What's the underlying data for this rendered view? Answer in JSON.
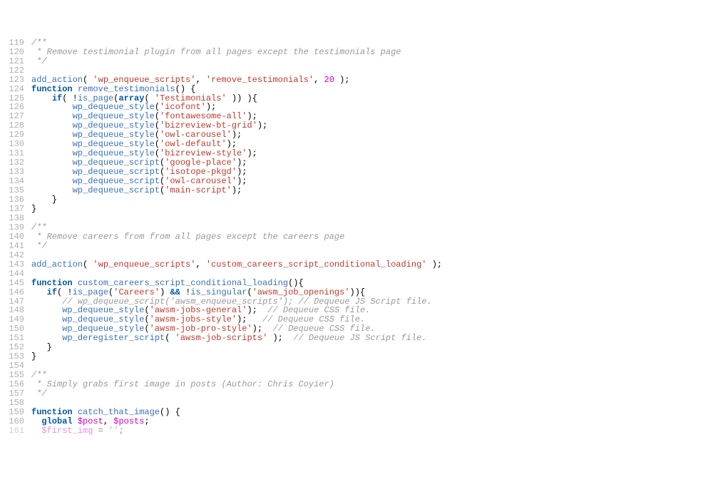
{
  "lines": [
    {
      "num": 119,
      "tokens": [
        [
          "c-comment",
          "/**"
        ]
      ]
    },
    {
      "num": 120,
      "tokens": [
        [
          "c-comment",
          " * Remove testimonial plugin from all pages except the testimonials page"
        ]
      ]
    },
    {
      "num": 121,
      "tokens": [
        [
          "c-comment",
          " */"
        ]
      ]
    },
    {
      "num": 122,
      "tokens": []
    },
    {
      "num": 123,
      "tokens": [
        [
          "c-func",
          "add_action"
        ],
        [
          "c-punct",
          "( "
        ],
        [
          "c-string",
          "'wp_enqueue_scripts'"
        ],
        [
          "c-punct",
          ", "
        ],
        [
          "c-string",
          "'remove_testimonials'"
        ],
        [
          "c-punct",
          ", "
        ],
        [
          "c-number",
          "20"
        ],
        [
          "c-punct",
          " );"
        ]
      ]
    },
    {
      "num": 124,
      "tokens": [
        [
          "c-keyword",
          "function"
        ],
        [
          "c-punct",
          " "
        ],
        [
          "c-func",
          "remove_testimonials"
        ],
        [
          "c-punct",
          "() {"
        ]
      ]
    },
    {
      "num": 125,
      "tokens": [
        [
          "c-punct",
          "    "
        ],
        [
          "c-keyword",
          "if"
        ],
        [
          "c-punct",
          "( !"
        ],
        [
          "c-func",
          "is_page"
        ],
        [
          "c-punct",
          "("
        ],
        [
          "c-keyword",
          "array"
        ],
        [
          "c-punct",
          "( "
        ],
        [
          "c-string",
          "'Testimonials'"
        ],
        [
          "c-punct",
          " )) ){"
        ]
      ]
    },
    {
      "num": 126,
      "tokens": [
        [
          "c-punct",
          "        "
        ],
        [
          "c-func",
          "wp_dequeue_style"
        ],
        [
          "c-punct",
          "("
        ],
        [
          "c-string",
          "'icofont'"
        ],
        [
          "c-punct",
          ");"
        ]
      ]
    },
    {
      "num": 127,
      "tokens": [
        [
          "c-punct",
          "        "
        ],
        [
          "c-func",
          "wp_dequeue_style"
        ],
        [
          "c-punct",
          "("
        ],
        [
          "c-string",
          "'fontawesome-all'"
        ],
        [
          "c-punct",
          ");"
        ]
      ]
    },
    {
      "num": 128,
      "tokens": [
        [
          "c-punct",
          "        "
        ],
        [
          "c-func",
          "wp_dequeue_style"
        ],
        [
          "c-punct",
          "("
        ],
        [
          "c-string",
          "'bizreview-bt-grid'"
        ],
        [
          "c-punct",
          ");"
        ]
      ]
    },
    {
      "num": 129,
      "tokens": [
        [
          "c-punct",
          "        "
        ],
        [
          "c-func",
          "wp_dequeue_style"
        ],
        [
          "c-punct",
          "("
        ],
        [
          "c-string",
          "'owl-carousel'"
        ],
        [
          "c-punct",
          ");"
        ]
      ]
    },
    {
      "num": 130,
      "tokens": [
        [
          "c-punct",
          "        "
        ],
        [
          "c-func",
          "wp_dequeue_style"
        ],
        [
          "c-punct",
          "("
        ],
        [
          "c-string",
          "'owl-default'"
        ],
        [
          "c-punct",
          ");"
        ]
      ]
    },
    {
      "num": 131,
      "tokens": [
        [
          "c-punct",
          "        "
        ],
        [
          "c-func",
          "wp_dequeue_style"
        ],
        [
          "c-punct",
          "("
        ],
        [
          "c-string",
          "'bizreview-style'"
        ],
        [
          "c-punct",
          ");"
        ]
      ]
    },
    {
      "num": 132,
      "tokens": [
        [
          "c-punct",
          "        "
        ],
        [
          "c-func",
          "wp_dequeue_script"
        ],
        [
          "c-punct",
          "("
        ],
        [
          "c-string",
          "'google-place'"
        ],
        [
          "c-punct",
          ");"
        ]
      ]
    },
    {
      "num": 133,
      "tokens": [
        [
          "c-punct",
          "        "
        ],
        [
          "c-func",
          "wp_dequeue_script"
        ],
        [
          "c-punct",
          "("
        ],
        [
          "c-string",
          "'isotope-pkgd'"
        ],
        [
          "c-punct",
          ");"
        ]
      ]
    },
    {
      "num": 134,
      "tokens": [
        [
          "c-punct",
          "        "
        ],
        [
          "c-func",
          "wp_dequeue_script"
        ],
        [
          "c-punct",
          "("
        ],
        [
          "c-string",
          "'owl-carousel'"
        ],
        [
          "c-punct",
          ");"
        ]
      ]
    },
    {
      "num": 135,
      "tokens": [
        [
          "c-punct",
          "        "
        ],
        [
          "c-func",
          "wp_dequeue_script"
        ],
        [
          "c-punct",
          "("
        ],
        [
          "c-string",
          "'main-script'"
        ],
        [
          "c-punct",
          ");"
        ]
      ]
    },
    {
      "num": 136,
      "tokens": [
        [
          "c-punct",
          "    }"
        ]
      ]
    },
    {
      "num": 137,
      "tokens": [
        [
          "c-punct",
          "}"
        ]
      ]
    },
    {
      "num": 138,
      "tokens": []
    },
    {
      "num": 139,
      "tokens": [
        [
          "c-comment",
          "/**"
        ]
      ]
    },
    {
      "num": 140,
      "tokens": [
        [
          "c-comment",
          " * Remove careers from from all pages except the careers page"
        ]
      ]
    },
    {
      "num": 141,
      "tokens": [
        [
          "c-comment",
          " */"
        ]
      ]
    },
    {
      "num": 142,
      "tokens": []
    },
    {
      "num": 143,
      "tokens": [
        [
          "c-func",
          "add_action"
        ],
        [
          "c-punct",
          "( "
        ],
        [
          "c-string",
          "'wp_enqueue_scripts'"
        ],
        [
          "c-punct",
          ", "
        ],
        [
          "c-string",
          "'custom_careers_script_conditional_loading'"
        ],
        [
          "c-punct",
          " );"
        ]
      ]
    },
    {
      "num": 144,
      "tokens": []
    },
    {
      "num": 145,
      "tokens": [
        [
          "c-keyword",
          "function"
        ],
        [
          "c-punct",
          " "
        ],
        [
          "c-func",
          "custom_careers_script_conditional_loading"
        ],
        [
          "c-punct",
          "(){"
        ]
      ]
    },
    {
      "num": 146,
      "tokens": [
        [
          "c-punct",
          "   "
        ],
        [
          "c-keyword",
          "if"
        ],
        [
          "c-punct",
          "( !"
        ],
        [
          "c-func",
          "is_page"
        ],
        [
          "c-punct",
          "("
        ],
        [
          "c-string",
          "'Careers'"
        ],
        [
          "c-punct",
          ") "
        ],
        [
          "c-keyword",
          "&&"
        ],
        [
          "c-punct",
          " !"
        ],
        [
          "c-func",
          "is_singular"
        ],
        [
          "c-punct",
          "("
        ],
        [
          "c-string",
          "'awsm_job_openings'"
        ],
        [
          "c-punct",
          ")){"
        ]
      ]
    },
    {
      "num": 147,
      "tokens": [
        [
          "c-punct",
          "      "
        ],
        [
          "c-comment",
          "// wp_dequeue_script('awsm_enqueue_scripts'); // Dequeue JS Script file."
        ]
      ]
    },
    {
      "num": 148,
      "tokens": [
        [
          "c-punct",
          "      "
        ],
        [
          "c-func",
          "wp_dequeue_style"
        ],
        [
          "c-punct",
          "("
        ],
        [
          "c-string",
          "'awsm-jobs-general'"
        ],
        [
          "c-punct",
          ");  "
        ],
        [
          "c-comment",
          "// Dequeue CSS file."
        ]
      ]
    },
    {
      "num": 149,
      "tokens": [
        [
          "c-punct",
          "      "
        ],
        [
          "c-func",
          "wp_dequeue_style"
        ],
        [
          "c-punct",
          "("
        ],
        [
          "c-string",
          "'awsm-jobs-style'"
        ],
        [
          "c-punct",
          ");   "
        ],
        [
          "c-comment",
          "// Dequeue CSS file."
        ]
      ]
    },
    {
      "num": 150,
      "tokens": [
        [
          "c-punct",
          "      "
        ],
        [
          "c-func",
          "wp_dequeue_style"
        ],
        [
          "c-punct",
          "("
        ],
        [
          "c-string",
          "'awsm-job-pro-style'"
        ],
        [
          "c-punct",
          ");  "
        ],
        [
          "c-comment",
          "// Dequeue CSS file."
        ]
      ]
    },
    {
      "num": 151,
      "tokens": [
        [
          "c-punct",
          "      "
        ],
        [
          "c-func",
          "wp_deregister_script"
        ],
        [
          "c-punct",
          "( "
        ],
        [
          "c-string",
          "'awsm-job-scripts'"
        ],
        [
          "c-punct",
          " );  "
        ],
        [
          "c-comment",
          "// Dequeue JS Script file."
        ]
      ]
    },
    {
      "num": 152,
      "tokens": [
        [
          "c-punct",
          "   }"
        ]
      ]
    },
    {
      "num": 153,
      "tokens": [
        [
          "c-punct",
          "}"
        ]
      ]
    },
    {
      "num": 154,
      "tokens": []
    },
    {
      "num": 155,
      "tokens": [
        [
          "c-comment",
          "/**"
        ]
      ]
    },
    {
      "num": 156,
      "tokens": [
        [
          "c-comment",
          " * Simply grabs first image in posts (Author: Chris Coyier)"
        ]
      ]
    },
    {
      "num": 157,
      "tokens": [
        [
          "c-comment",
          " */"
        ]
      ]
    },
    {
      "num": 158,
      "tokens": []
    },
    {
      "num": 159,
      "tokens": [
        [
          "c-keyword",
          "function"
        ],
        [
          "c-punct",
          " "
        ],
        [
          "c-func",
          "catch_that_image"
        ],
        [
          "c-punct",
          "() {"
        ]
      ]
    },
    {
      "num": 160,
      "tokens": [
        [
          "c-punct",
          "  "
        ],
        [
          "c-keyword",
          "global"
        ],
        [
          "c-punct",
          " "
        ],
        [
          "c-var",
          "$post"
        ],
        [
          "c-punct",
          ", "
        ],
        [
          "c-var",
          "$posts"
        ],
        [
          "c-punct",
          ";"
        ]
      ]
    },
    {
      "num": 161,
      "tokens": [
        [
          "c-punct",
          "  "
        ],
        [
          "c-var",
          "$first_img"
        ],
        [
          "c-punct",
          " = "
        ],
        [
          "c-string",
          "''"
        ],
        [
          "c-punct",
          ";"
        ]
      ],
      "faded": true
    }
  ]
}
